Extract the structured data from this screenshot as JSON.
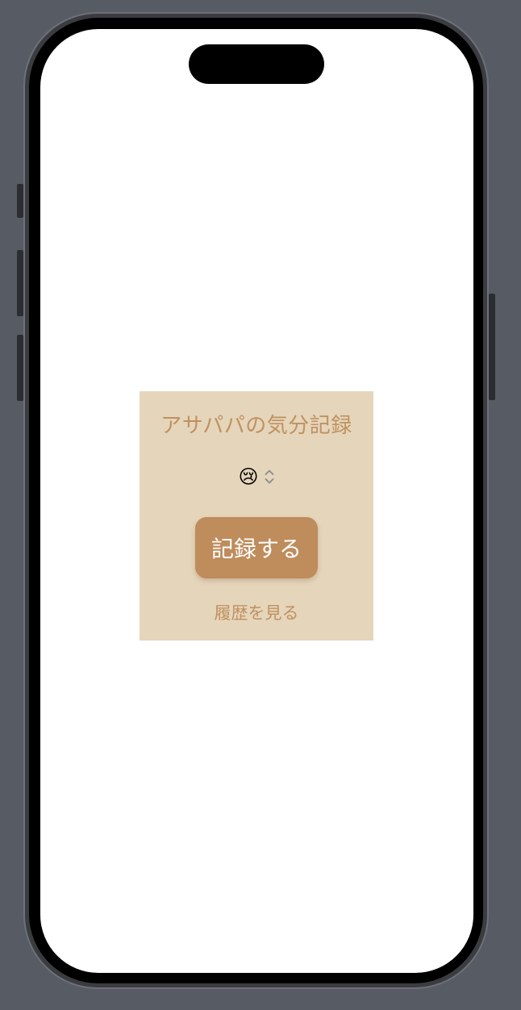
{
  "app": {
    "title": "アサパパの気分記録"
  },
  "mood_picker": {
    "selected_emoji": "😢",
    "icon": "chevron-up-down-icon"
  },
  "actions": {
    "record_label": "記録する",
    "history_label": "履歴を見る"
  },
  "colors": {
    "background": "#575c64",
    "card": "#e5d5bb",
    "accent": "#c0915f",
    "button": "#bf8c5c",
    "button_text": "#ffffff"
  }
}
